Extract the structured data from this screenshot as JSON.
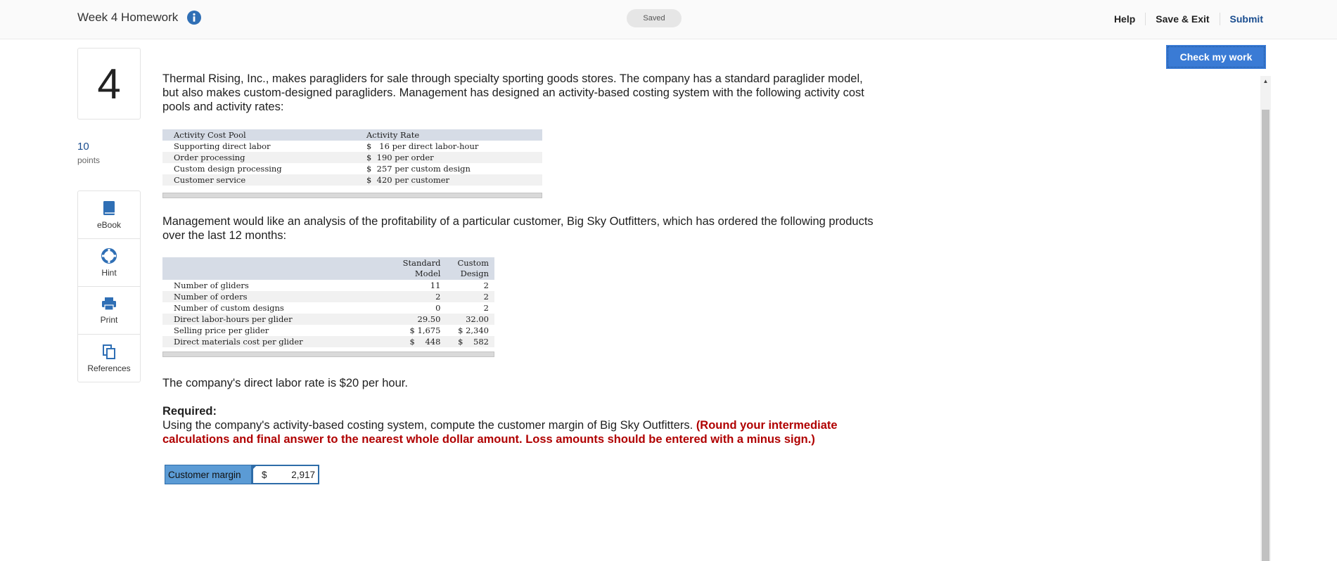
{
  "header": {
    "title": "Week 4 Homework",
    "saved": "Saved",
    "help": "Help",
    "save_exit": "Save & Exit",
    "submit": "Submit"
  },
  "question": {
    "number": "4",
    "points_value": "10",
    "points_label": "points"
  },
  "tools": {
    "ebook": "eBook",
    "hint": "Hint",
    "print": "Print",
    "references": "References"
  },
  "check_button": "Check my work",
  "content": {
    "intro": "Thermal Rising, Inc., makes paragliders for sale through specialty sporting goods stores. The company has a standard paraglider model, but also makes custom-designed paragliders. Management has designed an activity-based costing system with the following activity cost pools and activity rates:",
    "analysis": "Management would like an analysis of the profitability of a particular customer, Big Sky Outfitters, which has ordered the following products over the last 12 months:",
    "labor_rate": "The company's direct labor rate is $20 per hour.",
    "required_title": "Required:",
    "required_text": "Using the company's activity-based costing system, compute the customer margin of Big Sky Outfitters.",
    "required_note": "(Round your intermediate calculations and final answer to the nearest whole dollar amount. Loss amounts should be entered with a minus sign.)"
  },
  "rates_table": {
    "headers": [
      "Activity Cost Pool",
      "Activity Rate"
    ],
    "rows": [
      [
        "Supporting direct labor",
        "$   16 per direct labor-hour"
      ],
      [
        "Order processing",
        "$  190 per order"
      ],
      [
        "Custom design processing",
        "$  257 per custom design"
      ],
      [
        "Customer service",
        "$  420 per customer"
      ]
    ]
  },
  "products_table": {
    "headers": [
      "",
      "Standard\nModel",
      "Custom\nDesign"
    ],
    "rows": [
      [
        "Number of gliders",
        "11",
        "2"
      ],
      [
        "Number of orders",
        "2",
        "2"
      ],
      [
        "Number of custom designs",
        "0",
        "2"
      ],
      [
        "Direct labor-hours per glider",
        "29.50",
        "32.00"
      ],
      [
        "Selling price per glider",
        "$ 1,675",
        "$ 2,340"
      ],
      [
        "Direct materials cost per glider",
        "$    448",
        "$    582"
      ]
    ]
  },
  "answer": {
    "label": "Customer margin",
    "currency": "$",
    "value": "2,917"
  },
  "colors": {
    "accent": "#3a7bd5",
    "link": "#1a4d8f",
    "warning": "#b00000",
    "table_header": "#d6dce6"
  }
}
